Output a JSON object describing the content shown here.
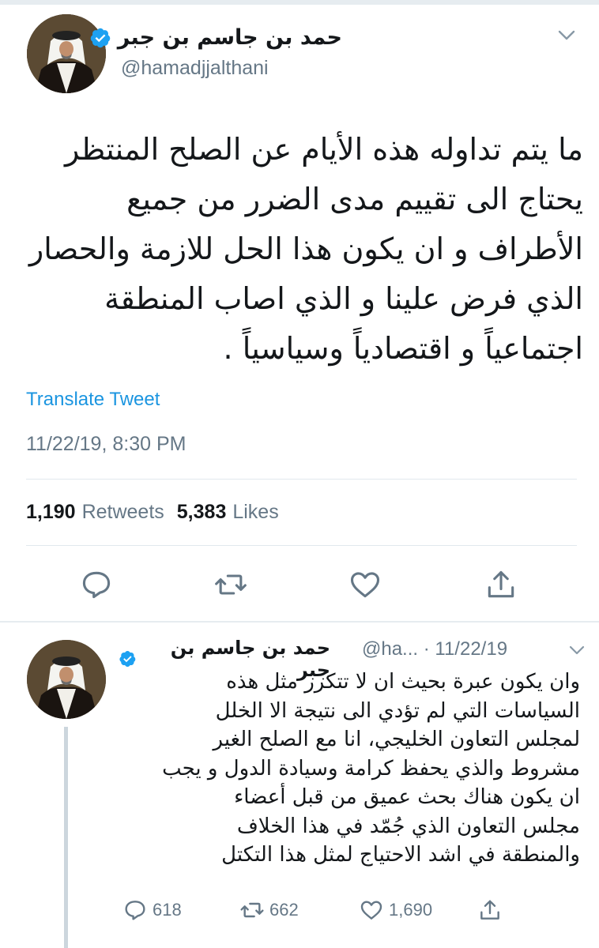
{
  "tweet": {
    "author_name": "حمد بن جاسم بن جبر",
    "handle": "@hamadjjalthani",
    "text_lines": [
      "ما يتم تداوله هذه الأيام عن الصلح المنتظر",
      "يحتاج  الى تقييم مدى الضرر من جميع",
      "الأطراف و ان يكون هذا الحل للازمة والحصار",
      "الذي فرض علينا  و الذي اصاب المنطقة",
      "اجتماعياً و اقتصادياً وسياسياً ."
    ],
    "translate_label": "Translate Tweet",
    "timestamp": "11/22/19, 8:30 PM",
    "retweets_count": "1,190",
    "retweets_label": "Retweets",
    "likes_count": "5,383",
    "likes_label": "Likes"
  },
  "reply": {
    "author_name": "حمد بن جاسم بن جبر",
    "handle_short": "@ha...",
    "date": "· 11/22/19",
    "text_lines": [
      "وان يكون عبرة بحيث ان لا تتكرر مثل هذه",
      "السياسات التي لم تؤدي الى نتيجة الا الخلل",
      "لمجلس التعاون الخليجي، انا مع الصلح الغير",
      "مشروط والذي يحفظ كرامة وسيادة الدول و يجب",
      "ان يكون هناك بحث عميق من قبل أعضاء",
      "مجلس التعاون الذي جُمّد في هذا الخلاف",
      "والمنطقة في اشد الاحتياج لمثل هذا التكتل"
    ],
    "replies_count": "618",
    "retweets_count": "662",
    "likes_count": "1,690"
  },
  "icons": {
    "verified": "verified-badge-icon",
    "chevron": "chevron-down-icon",
    "reply": "reply-icon",
    "retweet": "retweet-icon",
    "like": "heart-icon",
    "share": "share-icon"
  },
  "colors": {
    "accent": "#1b95e0",
    "verified": "#1da1f2",
    "secondary_text": "#657786",
    "primary_text": "#14171a",
    "icon": "#657786"
  }
}
